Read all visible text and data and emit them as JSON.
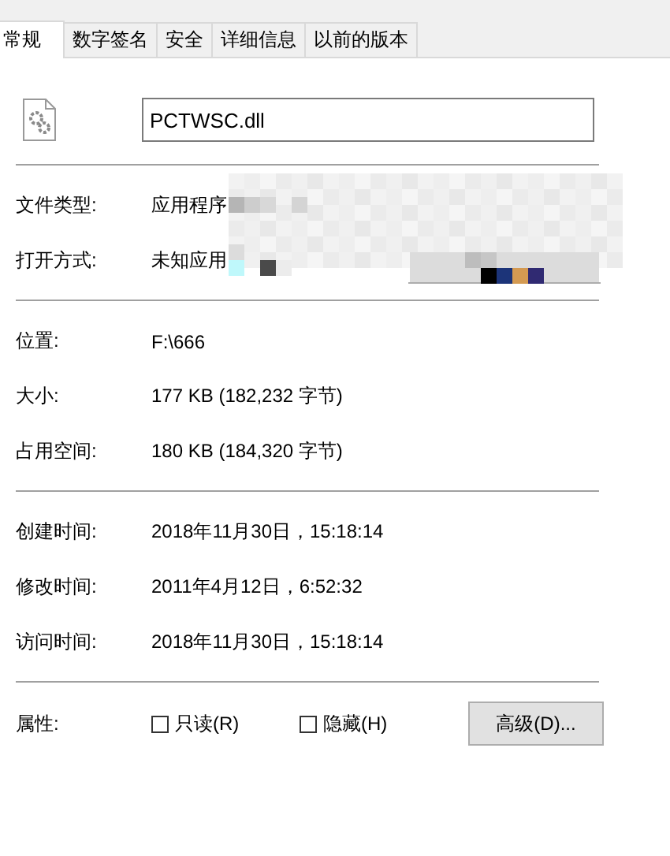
{
  "tabs": [
    {
      "label": "常规",
      "selected": true
    },
    {
      "label": "数字签名",
      "selected": false
    },
    {
      "label": "安全",
      "selected": false
    },
    {
      "label": "详细信息",
      "selected": false
    },
    {
      "label": "以前的版本",
      "selected": false
    }
  ],
  "file_name": "PCTWSC.dll",
  "sections": [
    [
      {
        "label": "文件类型:",
        "value": "应用程序"
      },
      {
        "label": "打开方式:",
        "value": "未知应用"
      }
    ],
    [
      {
        "label": "位置:",
        "value": "F:\\666"
      },
      {
        "label": "大小:",
        "value": "177 KB (182,232 字节)"
      },
      {
        "label": "占用空间:",
        "value": "180 KB (184,320 字节)"
      }
    ],
    [
      {
        "label": "创建时间:",
        "value": "2018年11月30日，15:18:14"
      },
      {
        "label": "修改时间:",
        "value": "2011年4月12日，6:52:32"
      },
      {
        "label": "访问时间:",
        "value": "2018年11月30日，15:18:14"
      }
    ]
  ],
  "attributes": {
    "label": "属性:",
    "checkboxes": [
      {
        "label": "只读(R)",
        "checked": false
      },
      {
        "label": "隐藏(H)",
        "checked": false
      }
    ],
    "button": "高级(D)..."
  }
}
